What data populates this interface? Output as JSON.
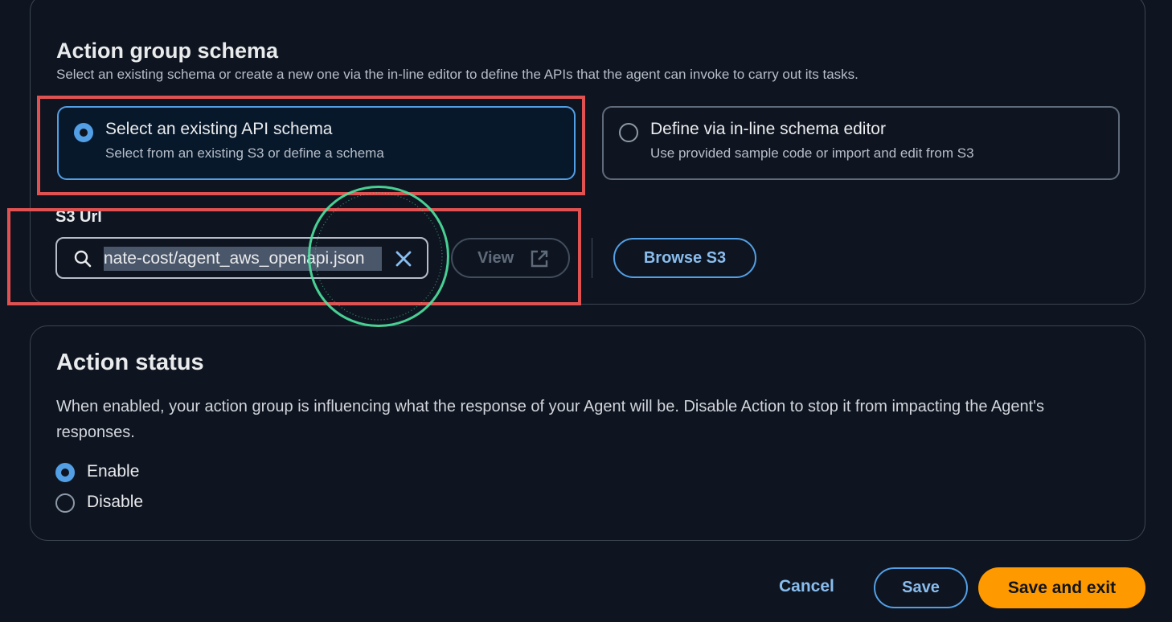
{
  "action_group_schema": {
    "title": "Action group schema",
    "description": "Select an existing schema or create a new one via the in-line editor to define the APIs that the agent can invoke to carry out its tasks.",
    "options": [
      {
        "title": "Select an existing API schema",
        "subtitle": "Select from an existing S3 or define a schema",
        "selected": true
      },
      {
        "title": "Define via in-line schema editor",
        "subtitle": "Use provided sample code or import and edit from S3",
        "selected": false
      }
    ],
    "s3_url": {
      "label": "S3 Url",
      "value": "nate-cost/agent_aws_openapi.json",
      "view_label": "View",
      "browse_label": "Browse S3"
    }
  },
  "action_status": {
    "title": "Action status",
    "description": "When enabled, your action group is influencing what the response of your Agent will be. Disable Action to stop it from impacting the Agent's responses.",
    "options": [
      {
        "label": "Enable",
        "selected": true
      },
      {
        "label": "Disable",
        "selected": false
      }
    ]
  },
  "footer": {
    "cancel_label": "Cancel",
    "save_label": "Save",
    "save_exit_label": "Save and exit"
  },
  "icons": {
    "search": "search-icon",
    "clear": "close-icon",
    "external": "external-link-icon"
  },
  "colors": {
    "background": "#0f1520",
    "accent": "#539fe5",
    "primary_button": "#ff9900",
    "annotation": "#e05252",
    "focus_ring": "#4fe3a0"
  }
}
